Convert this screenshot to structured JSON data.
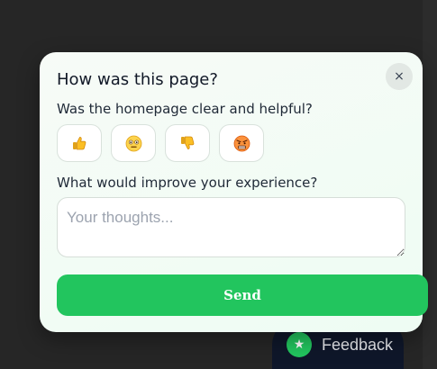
{
  "popup": {
    "title": "How was this page?",
    "close_label": "×",
    "question_rating": "Was the homepage clear and helpful?",
    "rating_options": [
      {
        "icon": "thumbs-up-icon"
      },
      {
        "icon": "neutral-face-icon"
      },
      {
        "icon": "thumbs-down-icon"
      },
      {
        "icon": "angry-face-icon"
      }
    ],
    "question_improve": "What would improve your experience?",
    "thoughts_placeholder": "Your thoughts...",
    "thoughts_value": "",
    "send_label": "Send"
  },
  "launcher": {
    "icon": "star-icon",
    "icon_glyph": "★",
    "label": "Feedback"
  },
  "colors": {
    "accent": "#22c55e",
    "launcher_bg": "#0f172a",
    "page_bg": "#262626"
  }
}
